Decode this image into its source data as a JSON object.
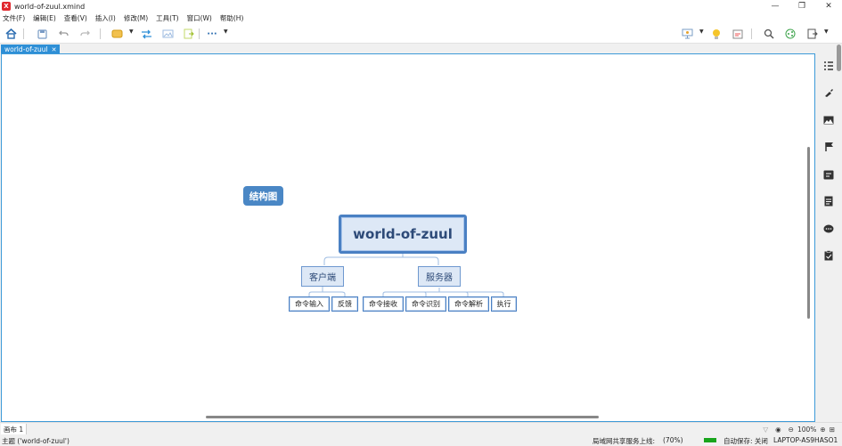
{
  "window": {
    "title": "world-of-zuul.xmind",
    "app_icon": "xmind-logo",
    "minimize": "—",
    "maximize": "❐",
    "close": "✕"
  },
  "menu": [
    "文件(F)",
    "编辑(E)",
    "查看(V)",
    "插入(I)",
    "修改(M)",
    "工具(T)",
    "窗口(W)",
    "帮助(H)"
  ],
  "toolbar": {
    "icons": [
      "home-icon",
      "save-icon",
      "undo-icon",
      "redo-icon",
      "topic-icon",
      "relationship-icon",
      "image-icon",
      "export-icon",
      "more-icon",
      "presentation-icon",
      "idea-icon",
      "panel-icon",
      "search-icon",
      "share-icon",
      "export-menu-icon"
    ],
    "more_label": "···"
  },
  "tab": {
    "label": "world-of-zuul",
    "close": "✕"
  },
  "mindmap": {
    "floating": "结构图",
    "central": "world-of-zuul",
    "main_topics": [
      {
        "label": "客户端",
        "children": [
          "命令输入",
          "反馈"
        ]
      },
      {
        "label": "服务器",
        "children": [
          "命令接收",
          "命令识别",
          "命令解析",
          "执行"
        ]
      }
    ],
    "colors": {
      "central_border": "#4a80c3",
      "central_fill": "#dde8f6",
      "floating_fill": "#4a87c5",
      "line": "#9fbde3"
    }
  },
  "side_panel": [
    "outline-icon",
    "format-icon",
    "image-icon",
    "marker-icon",
    "notes-icon",
    "task-icon",
    "comment-icon",
    "clipboard-icon"
  ],
  "sheetbar": {
    "sheet_label": "画布 1",
    "zoom": "100%",
    "zoom_out": "⊖",
    "zoom_in": "⊕",
    "eye": "◉"
  },
  "status": {
    "topic": "主题 ('world-of-zuul')",
    "share": "局域网共享服务上线:",
    "percent": "(70%)",
    "autosave": "自动保存: 关闭",
    "host": "LAPTOP-AS9HASO1"
  }
}
